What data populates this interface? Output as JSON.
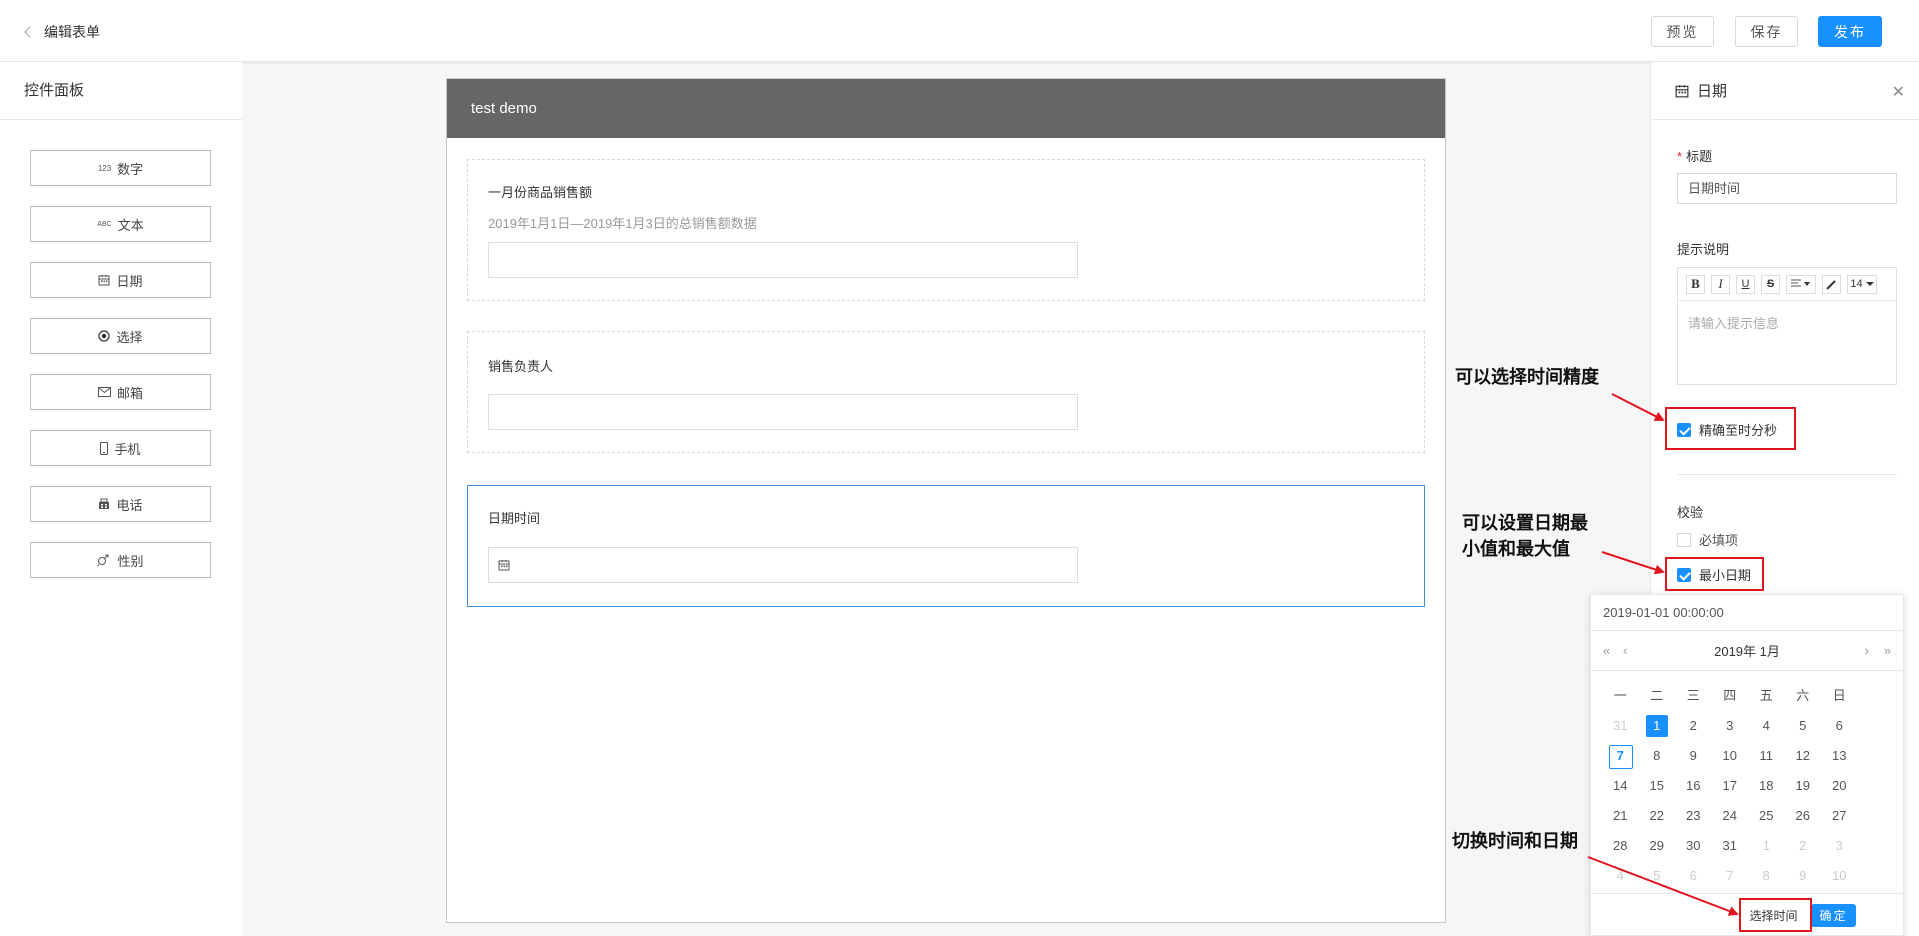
{
  "header": {
    "back_label": "编辑表单",
    "preview_label": "预览",
    "save_label": "保存",
    "publish_label": "发布"
  },
  "left_panel": {
    "title": "控件面板",
    "controls": [
      {
        "icon": "number-icon",
        "icon_text": "123",
        "label": "数字"
      },
      {
        "icon": "text-icon",
        "icon_text": "ABC",
        "label": "文本"
      },
      {
        "icon": "calendar-icon",
        "label": "日期"
      },
      {
        "icon": "radio-icon",
        "label": "选择"
      },
      {
        "icon": "mail-icon",
        "label": "邮箱"
      },
      {
        "icon": "mobile-icon",
        "label": "手机"
      },
      {
        "icon": "phone-icon",
        "label": "电话"
      },
      {
        "icon": "gender-icon",
        "label": "性别"
      }
    ]
  },
  "form": {
    "title": "test demo",
    "fields": [
      {
        "label": "一月份商品销售额",
        "hint": "2019年1月1日—2019年1月3日的总销售额数据"
      },
      {
        "label": "销售负责人"
      },
      {
        "label": "日期时间"
      }
    ]
  },
  "right_panel": {
    "title": "日期",
    "title_label": "标题",
    "title_value": "日期时间",
    "hint_label": "提示说明",
    "editor_placeholder": "请输入提示信息",
    "font_size": "14",
    "precise_label": "精确至时分秒",
    "precise_checked": true,
    "validation_label": "校验",
    "required_label": "必填项",
    "required_checked": false,
    "min_date_label": "最小日期",
    "min_date_checked": true
  },
  "date_picker": {
    "value": "2019-01-01 00:00:00",
    "month_label": "2019年 1月",
    "weekdays": [
      "一",
      "二",
      "三",
      "四",
      "五",
      "六",
      "日"
    ],
    "weeks": [
      [
        "31",
        "1",
        "2",
        "3",
        "4",
        "5",
        "6"
      ],
      [
        "7",
        "8",
        "9",
        "10",
        "11",
        "12",
        "13"
      ],
      [
        "14",
        "15",
        "16",
        "17",
        "18",
        "19",
        "20"
      ],
      [
        "21",
        "22",
        "23",
        "24",
        "25",
        "26",
        "27"
      ],
      [
        "28",
        "29",
        "30",
        "31",
        "1",
        "2",
        "3"
      ],
      [
        "4",
        "5",
        "6",
        "7",
        "8",
        "9",
        "10"
      ]
    ],
    "select_time_label": "选择时间",
    "ok_label": "确定"
  },
  "annotations": {
    "precision": "可以选择时间精度",
    "min_max_line1": "可以设置日期最",
    "min_max_line2": "小值和最大值",
    "switch": "切换时间和日期"
  },
  "colors": {
    "primary": "#1890ff",
    "annotation": "#e0141e",
    "form_header": "#666666"
  }
}
